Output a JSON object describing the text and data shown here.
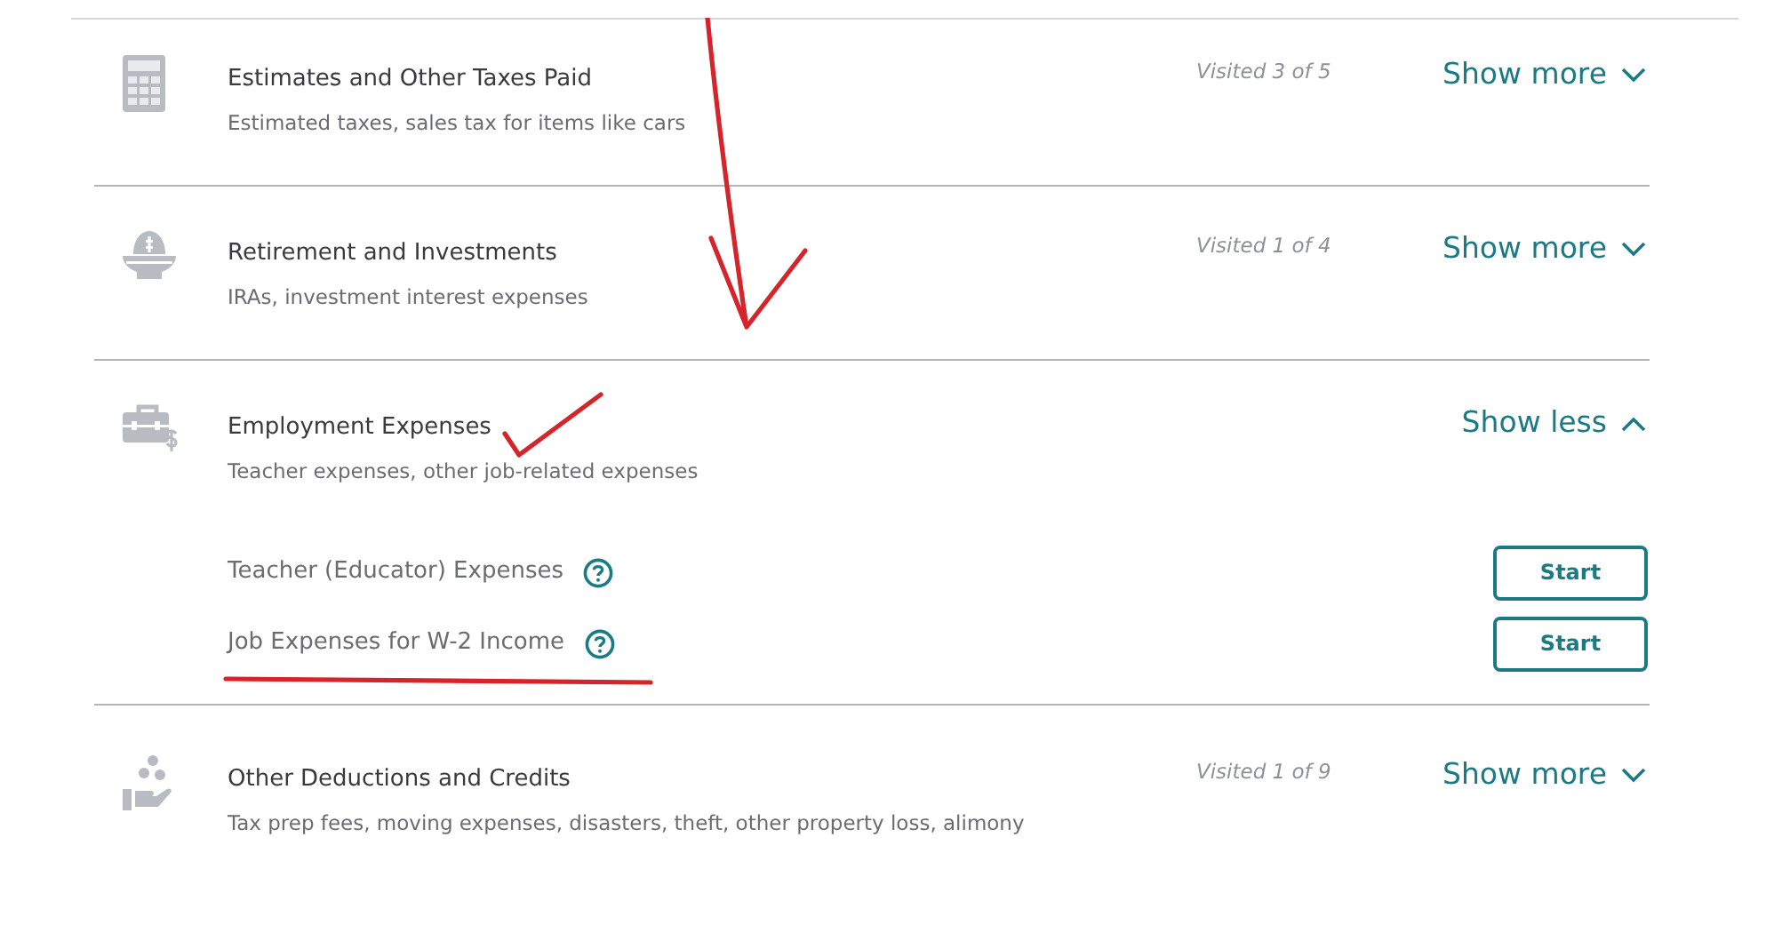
{
  "sections": [
    {
      "title": "Estimates and Other Taxes Paid",
      "subtitle": "Estimated taxes, sales tax for items like cars",
      "visited": "Visited 3 of 5",
      "expanded": false,
      "toggle": "Show more"
    },
    {
      "title": "Retirement and Investments",
      "subtitle": "IRAs, investment interest expenses",
      "visited": "Visited 1 of 4",
      "expanded": false,
      "toggle": "Show more"
    },
    {
      "title": "Employment Expenses",
      "subtitle": "Teacher expenses, other job-related expenses",
      "expanded": true,
      "toggle": "Show less",
      "items": [
        {
          "label": "Teacher (Educator) Expenses",
          "button": "Start"
        },
        {
          "label": "Job Expenses for W-2 Income",
          "button": "Start"
        }
      ]
    },
    {
      "title": "Other Deductions and Credits",
      "subtitle": "Tax prep fees, moving expenses, disasters, theft, other property loss, alimony",
      "visited": "Visited 1 of 9",
      "expanded": false,
      "toggle": "Show more"
    }
  ],
  "annotations": [
    {
      "kind": "arrow"
    },
    {
      "kind": "check"
    },
    {
      "kind": "underline"
    }
  ]
}
